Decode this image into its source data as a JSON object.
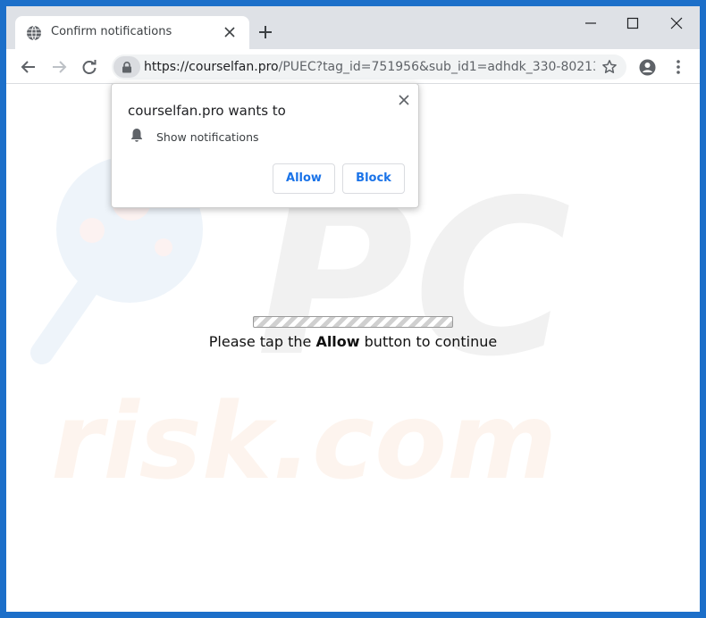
{
  "tab": {
    "title": "Confirm notifications",
    "icon": "globe-icon"
  },
  "toolbar": {
    "url_host": "https://courselfan.pro",
    "url_path": "/PUEC?tag_id=751956&sub_id1=adhdk_330-80213...",
    "lock_icon": "lock-icon"
  },
  "popup": {
    "title": "courselfan.pro wants to",
    "permission": "Show notifications",
    "allow_label": "Allow",
    "block_label": "Block"
  },
  "page": {
    "message_before": "Please tap the ",
    "message_bold": "Allow",
    "message_after": " button to continue",
    "progress_state": "indeterminate"
  },
  "watermark": {
    "line1": "PC",
    "line2": "risk.com"
  },
  "colors": {
    "window_frame": "#1c6fc9",
    "titlebar": "#dee1e6",
    "accent": "#1a73e8"
  }
}
